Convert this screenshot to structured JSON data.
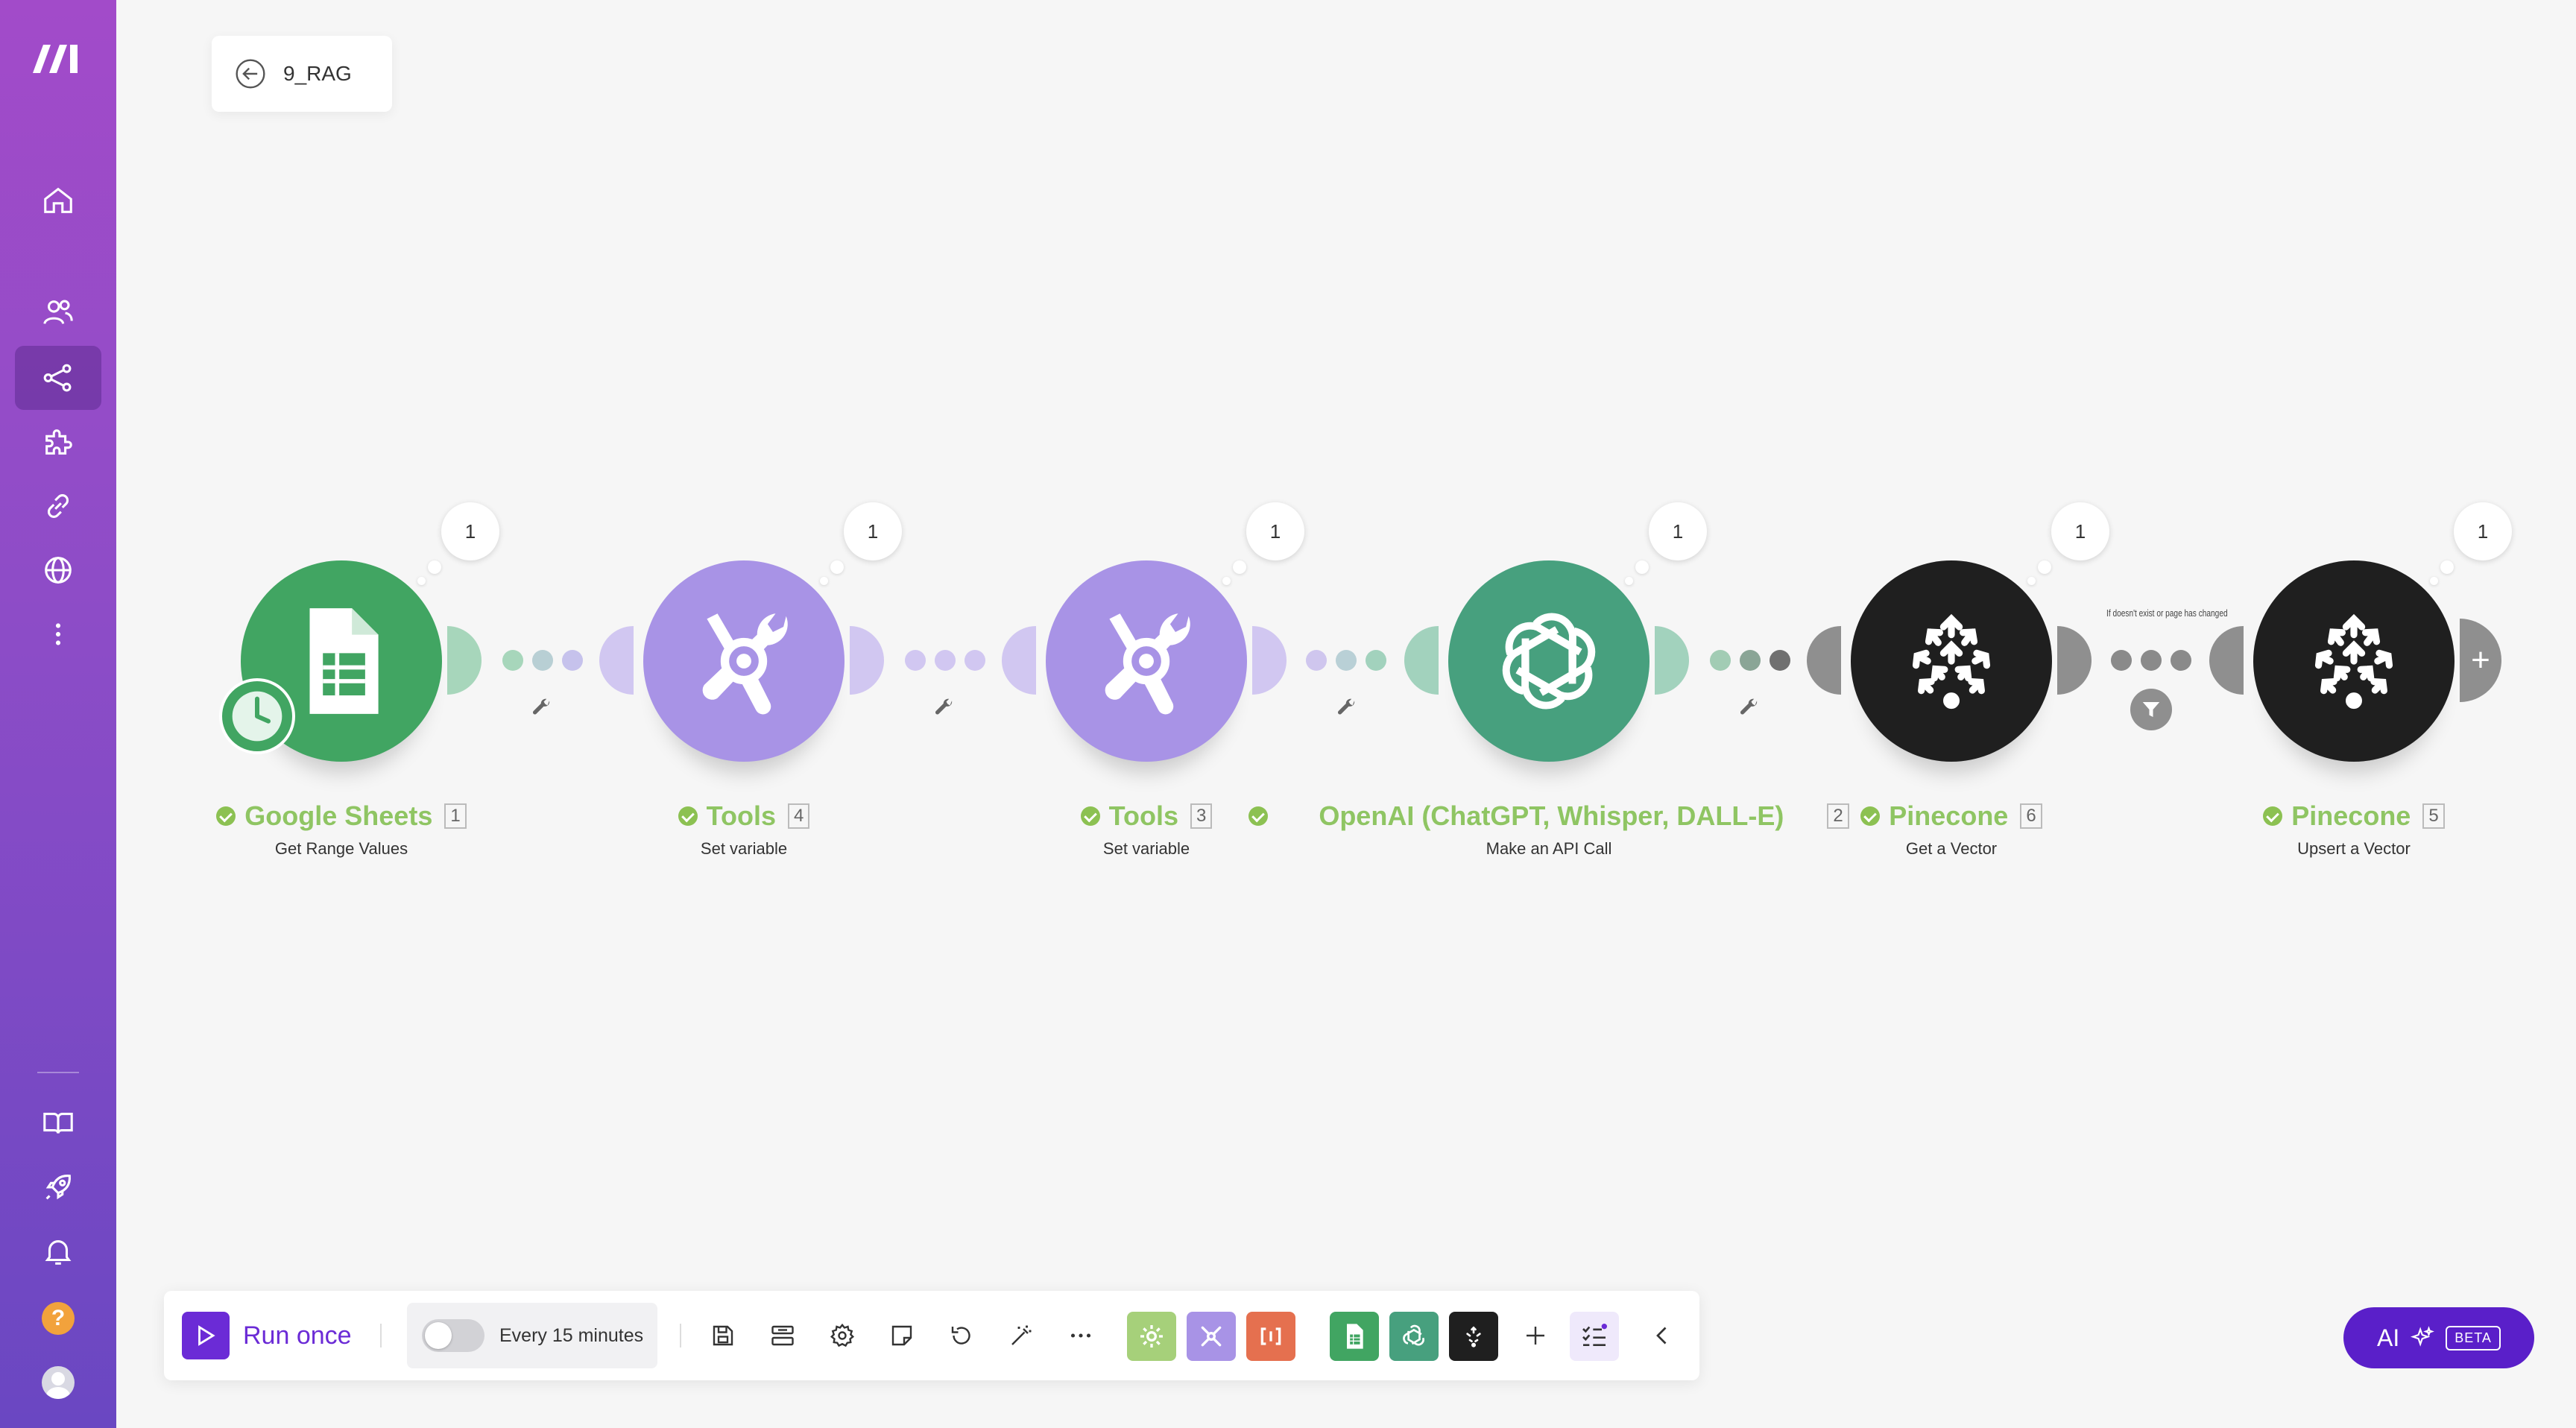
{
  "sidebar": {
    "items": [
      {
        "name": "home"
      },
      {
        "name": "team"
      },
      {
        "name": "scenarios",
        "active": true
      },
      {
        "name": "apps"
      },
      {
        "name": "connections"
      },
      {
        "name": "webhooks"
      },
      {
        "name": "more"
      }
    ],
    "bottom_items": [
      {
        "name": "docs"
      },
      {
        "name": "launch"
      },
      {
        "name": "notifications"
      },
      {
        "name": "help",
        "label": "?"
      },
      {
        "name": "profile"
      }
    ]
  },
  "scenario": {
    "name": "9_RAG"
  },
  "modules": [
    {
      "id": "1",
      "title": "Google Sheets",
      "subtitle": "Get Range Values",
      "bubble": "1",
      "color": "#41a562",
      "icon": "google-sheets-icon"
    },
    {
      "id": "4",
      "title": "Tools",
      "subtitle": "Set variable",
      "bubble": "1",
      "color": "#a893e6",
      "icon": "tools-icon"
    },
    {
      "id": "3",
      "title": "Tools",
      "subtitle": "Set variable",
      "bubble": "1",
      "color": "#a893e6",
      "icon": "tools-icon"
    },
    {
      "id": "2",
      "title": "OpenAI (ChatGPT, Whisper, DALL-E)",
      "subtitle": "Make an API Call",
      "bubble": "1",
      "color": "#47a07e",
      "icon": "openai-icon"
    },
    {
      "id": "6",
      "title": "Pinecone",
      "subtitle": "Get a Vector",
      "bubble": "1",
      "color": "#1f1f1f",
      "icon": "pinecone-icon"
    },
    {
      "id": "5",
      "title": "Pinecone",
      "subtitle": "Upsert a Vector",
      "bubble": "1",
      "color": "#1f1f1f",
      "icon": "pinecone-icon"
    }
  ],
  "filter": {
    "label": "If doesn't exist or page has changed"
  },
  "toolbar": {
    "run_label": "Run once",
    "schedule_label": "Every 15 minutes",
    "schedule_enabled": false
  },
  "ai": {
    "label": "AI",
    "badge": "BETA"
  },
  "colors": {
    "accent": "#6b2bd6",
    "success": "#8cc152",
    "sidebar_top": "#a24bc9",
    "sidebar_bottom": "#6a47c2"
  }
}
